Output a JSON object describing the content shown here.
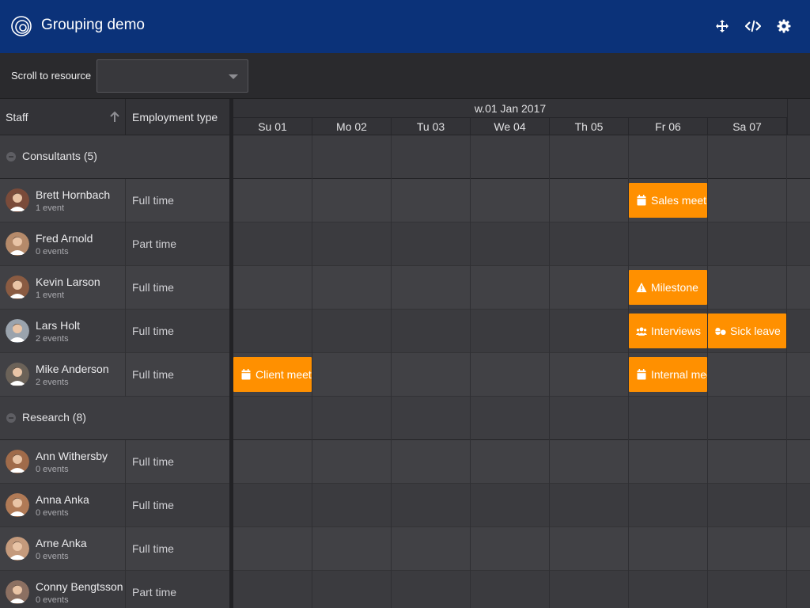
{
  "app": {
    "title": "Grouping demo"
  },
  "header_tools": [
    {
      "name": "move-icon"
    },
    {
      "name": "code-icon"
    },
    {
      "name": "gear-icon"
    }
  ],
  "toolbar": {
    "scroll_label": "Scroll to resource",
    "scroll_value": ""
  },
  "columns": {
    "staff": "Staff",
    "employment": "Employment type"
  },
  "timeline": {
    "week_label": "w.01 Jan 2017",
    "days": [
      "Su 01",
      "Mo 02",
      "Tu 03",
      "We 04",
      "Th 05",
      "Fr 06",
      "Sa 07"
    ]
  },
  "groups": [
    {
      "label": "Consultants (5)",
      "resources": [
        {
          "name": "Brett Hornbach",
          "events": "1 event",
          "employment": "Full time",
          "avatar_color": "#7a4b3a"
        },
        {
          "name": "Fred Arnold",
          "events": "0 events",
          "employment": "Part time",
          "avatar_color": "#b58a6a"
        },
        {
          "name": "Kevin Larson",
          "events": "1 event",
          "employment": "Full time",
          "avatar_color": "#8a5b42"
        },
        {
          "name": "Lars Holt",
          "events": "2 events",
          "employment": "Full time",
          "avatar_color": "#9aa3ad"
        },
        {
          "name": "Mike Anderson",
          "events": "2 events",
          "employment": "Full time",
          "avatar_color": "#6b6258"
        }
      ]
    },
    {
      "label": "Research (8)",
      "resources": [
        {
          "name": "Ann Withersby",
          "events": "0 events",
          "employment": "Full time",
          "avatar_color": "#a06b4a"
        },
        {
          "name": "Anna Anka",
          "events": "0 events",
          "employment": "Full time",
          "avatar_color": "#b07a56"
        },
        {
          "name": "Arne Anka",
          "events": "0 events",
          "employment": "Full time",
          "avatar_color": "#c49a7c"
        },
        {
          "name": "Conny Bengtsson",
          "events": "0 events",
          "employment": "Part time",
          "avatar_color": "#8c7062"
        }
      ]
    }
  ],
  "events": [
    {
      "resource": "Brett Hornbach",
      "day": "Fr 06",
      "text": "Sales meet",
      "icon": "calendar-icon",
      "color": "#ff9000"
    },
    {
      "resource": "Kevin Larson",
      "day": "Fr 06",
      "text": "Milestone",
      "icon": "warning-icon",
      "color": "#ff9000"
    },
    {
      "resource": "Lars Holt",
      "day": "Fr 06",
      "text": "Interviews",
      "icon": "users-icon",
      "color": "#ff9000"
    },
    {
      "resource": "Lars Holt",
      "day": "Sa 07",
      "text": "Sick leave",
      "icon": "pills-icon",
      "color": "#ff9000"
    },
    {
      "resource": "Mike Anderson",
      "day": "Su 01",
      "text": "Client meet",
      "icon": "calendar-icon",
      "color": "#ff9000"
    },
    {
      "resource": "Mike Anderson",
      "day": "Fr 06",
      "text": "Internal meet",
      "icon": "calendar-icon",
      "color": "#ff9000"
    }
  ]
}
